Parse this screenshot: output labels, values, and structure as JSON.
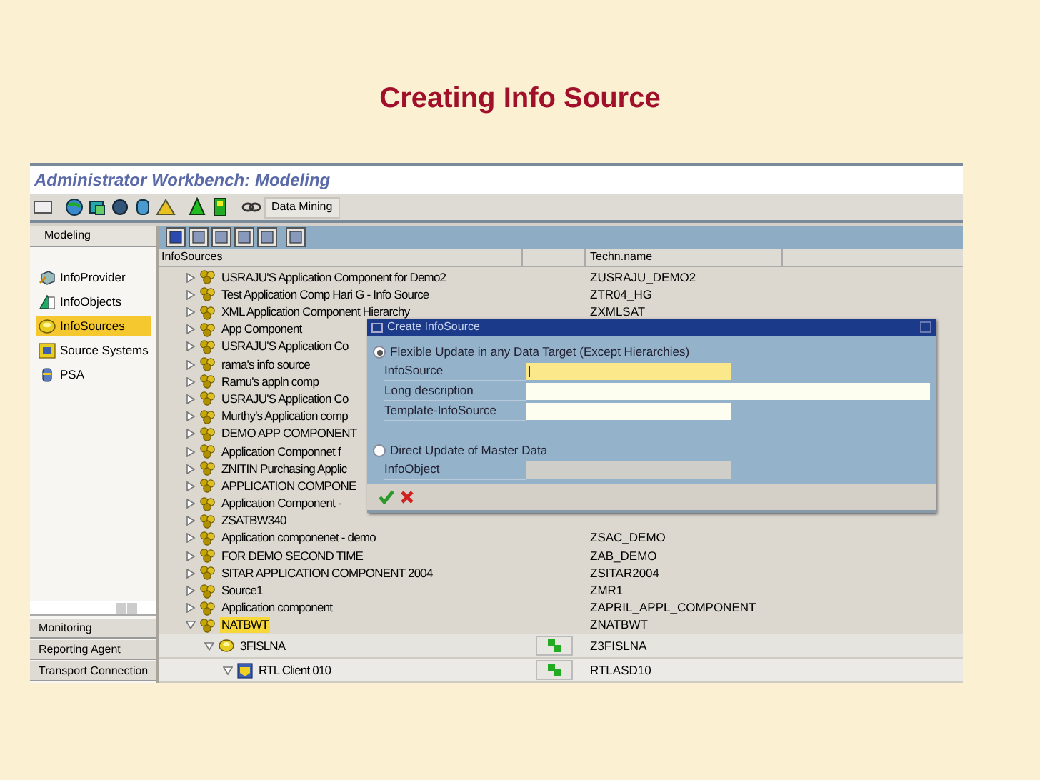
{
  "slide_title": "Creating Info Source",
  "window": {
    "title": "Administrator Workbench: Modeling"
  },
  "toolbar": {
    "button": "Data Mining"
  },
  "sidebar": {
    "header": "Modeling",
    "items": [
      {
        "label": "InfoProvider",
        "kind": "provider",
        "selected": false
      },
      {
        "label": "InfoObjects",
        "kind": "objects",
        "selected": false
      },
      {
        "label": "InfoSources",
        "kind": "sources",
        "selected": true
      },
      {
        "label": "Source Systems",
        "kind": "systems",
        "selected": false
      },
      {
        "label": "PSA",
        "kind": "psa",
        "selected": false
      }
    ],
    "bottom_buttons": [
      "Monitoring",
      "Reporting Agent",
      "Transport Connection"
    ]
  },
  "tree": {
    "columns": [
      "InfoSources",
      "Techn.name"
    ],
    "rows": [
      {
        "name": "USRAJU'S Application Component for Demo2",
        "techn": "ZUSRAJU_DEMO2",
        "kind": "component",
        "expanded": false,
        "selected": false
      },
      {
        "name": "Test Application Comp Hari G - Info Source",
        "techn": "ZTR04_HG",
        "kind": "component",
        "expanded": false,
        "selected": false
      },
      {
        "name": "XML Application Component Hierarchy",
        "techn": "ZXMLSAT",
        "kind": "component",
        "expanded": false,
        "selected": false
      },
      {
        "name": "App Component",
        "kind": "component",
        "expanded": false,
        "selected": false
      },
      {
        "name": "USRAJU'S Application Co",
        "kind": "component",
        "expanded": false,
        "selected": false
      },
      {
        "name": "rama's info source",
        "kind": "component",
        "expanded": false,
        "selected": false
      },
      {
        "name": "Ramu's appln comp",
        "kind": "component",
        "expanded": false,
        "selected": false
      },
      {
        "name": "USRAJU'S Application Co",
        "kind": "component",
        "expanded": false,
        "selected": false
      },
      {
        "name": "Murthy's Application comp",
        "kind": "component",
        "expanded": false,
        "selected": false
      },
      {
        "name": "DEMO APP COMPONENT",
        "kind": "component",
        "expanded": false,
        "selected": false
      },
      {
        "name": "Application Componnet f",
        "kind": "component",
        "expanded": false,
        "selected": false
      },
      {
        "name": "ZNITIN Purchasing Applic",
        "kind": "component",
        "expanded": false,
        "selected": false
      },
      {
        "name": "APPLICATION COMPONE",
        "kind": "component",
        "expanded": false,
        "selected": false
      },
      {
        "name": "Application Component -",
        "kind": "component",
        "expanded": false,
        "selected": false
      },
      {
        "name": "ZSATBW340",
        "kind": "component",
        "expanded": false,
        "selected": false
      },
      {
        "name": "Application componenet - demo",
        "techn": "ZSAC_DEMO",
        "kind": "component",
        "expanded": false,
        "selected": false
      },
      {
        "name": "FOR DEMO SECOND TIME",
        "techn": "ZAB_DEMO",
        "kind": "component",
        "expanded": false,
        "selected": false
      },
      {
        "name": "SITAR APPLICATION COMPONENT 2004",
        "techn": "ZSITAR2004",
        "kind": "component",
        "expanded": false,
        "selected": false
      },
      {
        "name": "Source1",
        "techn": "ZMR1",
        "kind": "component",
        "expanded": false,
        "selected": false
      },
      {
        "name": "Application component",
        "techn": "ZAPRIL_APPL_COMPONENT",
        "kind": "component",
        "expanded": false,
        "selected": false
      },
      {
        "name": "NATBWT",
        "techn": "ZNATBWT",
        "kind": "component",
        "expanded": true,
        "selected": true,
        "children": [
          {
            "name": "3FISLNA",
            "techn": "Z3FISLNA",
            "kind": "infosource",
            "expanded": true,
            "selected": false,
            "action_button": true,
            "children": [
              {
                "name": "RTL Client 010",
                "techn": "RTLASD10",
                "kind": "source_system",
                "expanded": true,
                "selected": false,
                "action_button": true
              }
            ]
          }
        ]
      }
    ]
  },
  "dialog": {
    "title": "Create InfoSource",
    "options": [
      {
        "label": "Flexible Update in any Data Target (Except Hierarchies)",
        "selected": true,
        "fields": [
          {
            "label": "InfoSource",
            "kind": "short",
            "focused": true,
            "disabled": false
          },
          {
            "label": "Long description",
            "kind": "long",
            "focused": false,
            "disabled": false
          },
          {
            "label": "Template-InfoSource",
            "kind": "short",
            "focused": false,
            "disabled": false
          }
        ]
      },
      {
        "label": "Direct Update of Master Data",
        "selected": false,
        "fields": [
          {
            "label": "InfoObject",
            "kind": "short",
            "focused": false,
            "disabled": true
          }
        ]
      }
    ]
  }
}
